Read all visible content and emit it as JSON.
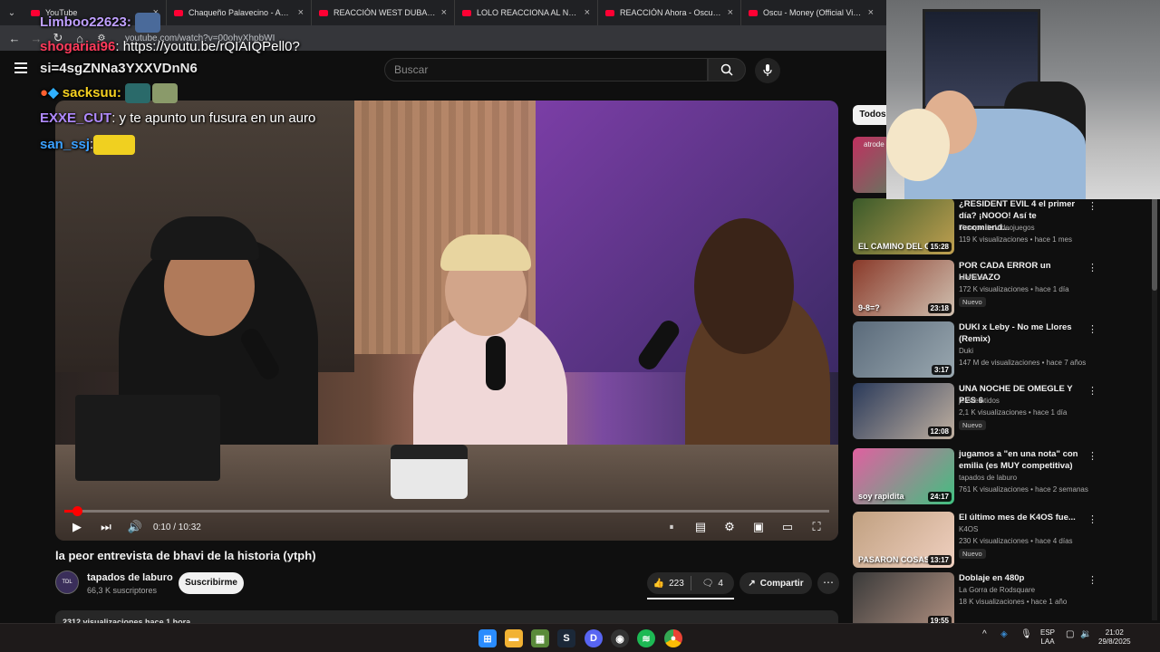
{
  "browser": {
    "tabs": [
      {
        "title": "YouTube"
      },
      {
        "title": "Chaqueño Palavecino - Amor S"
      },
      {
        "title": "REACCIÓN WEST DUBAI x DUK"
      },
      {
        "title": "LOLO REACCIONA AL NUEVO A"
      },
      {
        "title": "REACCIÓN Ahora - Oscu x Flex"
      },
      {
        "title": "Oscu - Money (Official Video)"
      }
    ],
    "url": "youtube.com/watch?v=00ohyXhpbWI"
  },
  "header": {
    "search_placeholder": "Buscar",
    "icons": [
      "menu-icon",
      "search-icon",
      "mic-icon"
    ]
  },
  "chat": [
    {
      "user": "Limboo22623:",
      "message": ""
    },
    {
      "user": "shogariai96",
      "message": ": https://youtu.be/rQIAIQPell0?"
    },
    {
      "user": "si=4sgZNNa3YXXVDnN6",
      "message": ""
    },
    {
      "user": "sacksuu:",
      "message": ""
    },
    {
      "user": "EXXE_CUT",
      "message": ": y te apunto un fusura en un auro"
    },
    {
      "user": "san_ssj",
      "message": ":"
    }
  ],
  "player": {
    "time": "0:10 / 10:32",
    "progress_fraction": 0.016,
    "accent": "#ff0000"
  },
  "video": {
    "title": "la peor entrevista de bhavi de la historia (ytph)",
    "channel": "tapados de laburo",
    "channel_avatar_text": "TDL",
    "subscribers": "66,3 K suscriptores",
    "subscribe_label": "Suscribirme",
    "likes": "223",
    "comments": "4",
    "share_label": "Compartir",
    "description_preview": "2312 visualizaciones hace 1 hora"
  },
  "sidebar": {
    "chip": "Todos",
    "recs": [
      {
        "title": "¿RESIDENT EVIL 4 el primer día? ¡NOOO! Así te recomiend...",
        "channel": "Tiempo de Videojuegos",
        "meta": "119 K visualizaciones • hace 1 mes",
        "duration": "15:28",
        "badge": "",
        "thumb_text": "EL CAMINO DEL GR"
      },
      {
        "title": "POR CADA ERROR un HUEVAZO",
        "channel": "Mernuel",
        "meta": "172 K visualizaciones • hace 1 día",
        "duration": "23:18",
        "badge": "Nuevo",
        "thumb_text": "9-8=?"
      },
      {
        "title": "DUKI x Leby - No me Llores (Remix)",
        "channel": "Duki",
        "meta": "147 M de visualizaciones • hace 7 años",
        "duration": "3:17",
        "badge": "",
        "thumb_text": ""
      },
      {
        "title": "UNA NOCHE DE OMEGLE Y PES 6",
        "channel": "jeroveintidos",
        "meta": "2,1 K visualizaciones • hace 1 día",
        "duration": "12:08",
        "badge": "Nuevo",
        "thumb_text": ""
      },
      {
        "title": "jugamos a \"en una nota\" con emilia (es MUY competitiva)",
        "channel": "tapados de laburo",
        "meta": "761 K visualizaciones • hace 2 semanas",
        "duration": "24:17",
        "badge": "",
        "thumb_text": "soy rapidita"
      },
      {
        "title": "El último mes de K4OS fue...",
        "channel": "K4OS",
        "meta": "230 K visualizaciones • hace 4 días",
        "duration": "13:17",
        "badge": "Nuevo",
        "thumb_text": "PASARON COSAS"
      },
      {
        "title": "Doblaje en 480p",
        "channel": "La Gorra de Rodsquare",
        "meta": "18 K visualizaciones • hace 1 año",
        "duration": "19:55",
        "badge": "",
        "thumb_text": ""
      }
    ]
  },
  "taskbar": {
    "apps": [
      "windows-icon",
      "folder-icon",
      "app-icon",
      "steam-icon",
      "discord-icon",
      "obs-icon",
      "spotify-icon",
      "chrome-icon"
    ],
    "lang": "ESP",
    "lang2": "LAA",
    "time": "21:02",
    "date": "29/8/2025"
  }
}
